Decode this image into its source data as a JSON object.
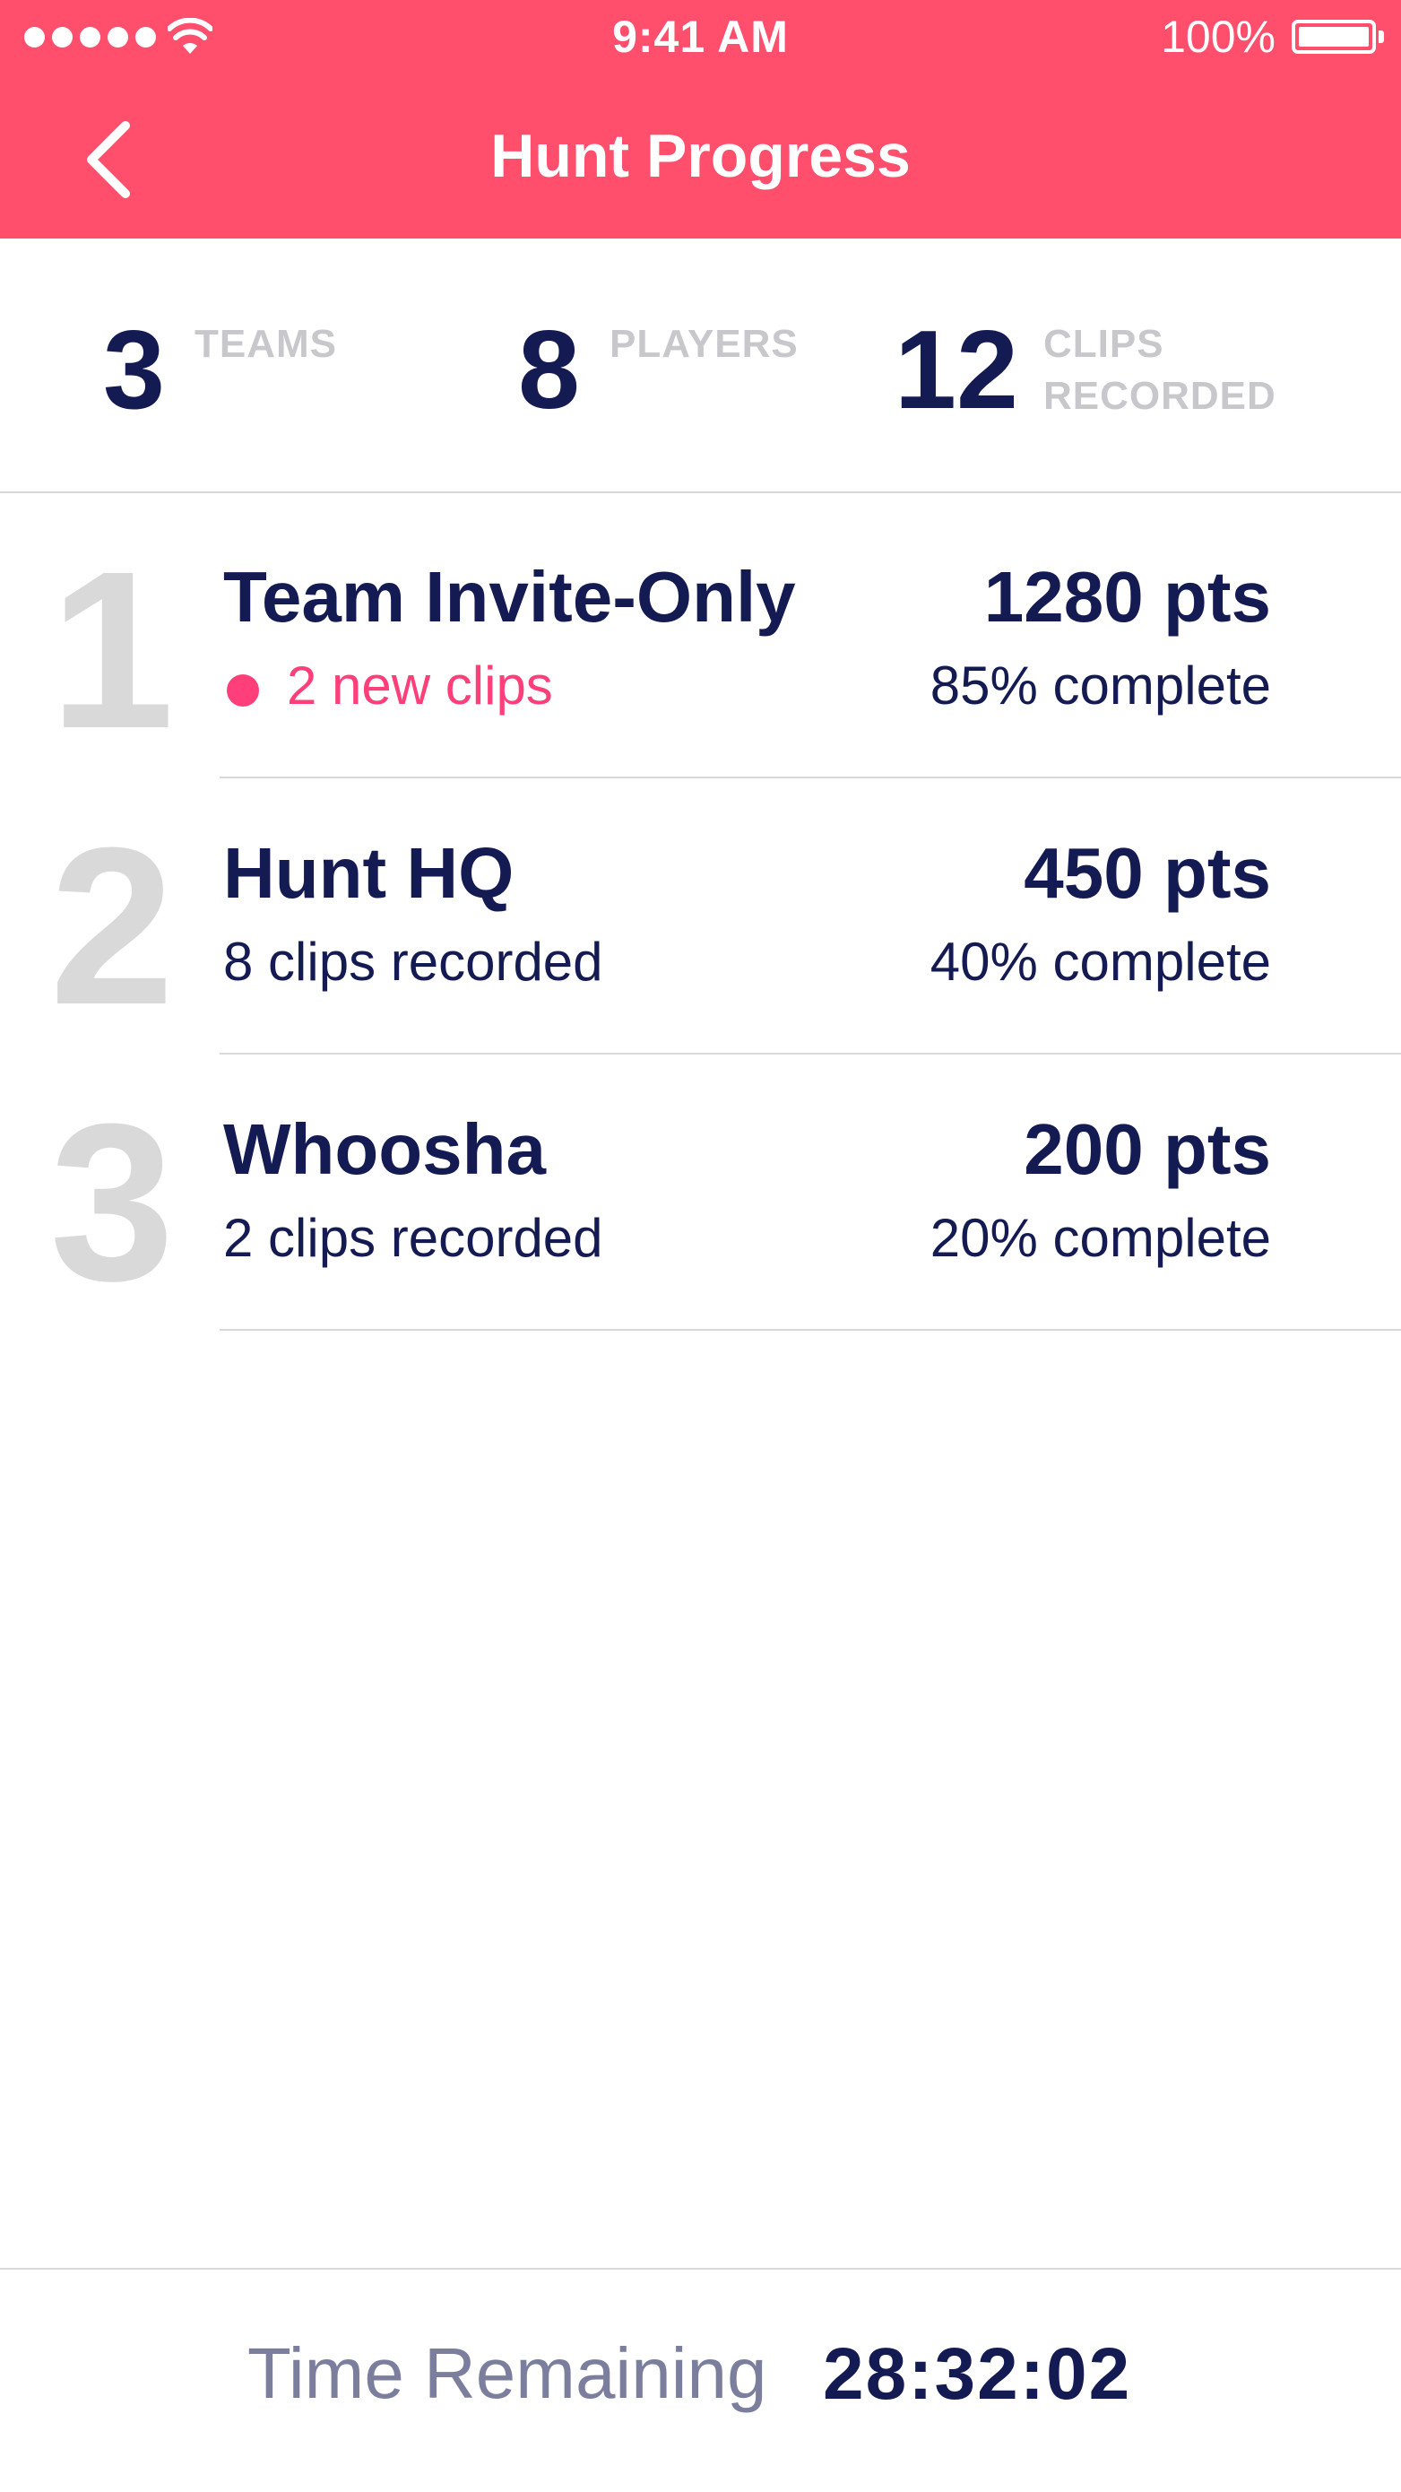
{
  "status_bar": {
    "time": "9:41 AM",
    "battery": "100%",
    "signal_icon": "signal-dots-icon",
    "wifi_icon": "wifi-icon",
    "battery_icon": "battery-icon"
  },
  "header": {
    "title": "Hunt Progress",
    "back_icon": "chevron-left-icon",
    "background_color": "#ff4f6c"
  },
  "stats": [
    {
      "value": "3",
      "label": "TEAMS"
    },
    {
      "value": "8",
      "label": "PLAYERS"
    },
    {
      "value": "12",
      "label": "CLIPS\nRECORDED"
    }
  ],
  "teams": [
    {
      "rank": "1",
      "name": "Team Invite-Only",
      "subtitle": "2 new clips",
      "points": "1280 pts",
      "progress": "85% complete",
      "has_new": true
    },
    {
      "rank": "2",
      "name": "Hunt HQ",
      "subtitle": "8 clips recorded",
      "points": "450 pts",
      "progress": "40% complete",
      "has_new": false
    },
    {
      "rank": "3",
      "name": "Whoosha",
      "subtitle": "2 clips recorded",
      "points": "200 pts",
      "progress": "20% complete",
      "has_new": false
    }
  ],
  "footer": {
    "label": "Time Remaining",
    "time": "28:32:02"
  },
  "colors": {
    "accent": "#ff4f6c",
    "new_clips": "#ff3f79",
    "text_primary": "#141a52",
    "rank_gray": "#d9d9d9",
    "label_gray": "#c8c8cc"
  }
}
